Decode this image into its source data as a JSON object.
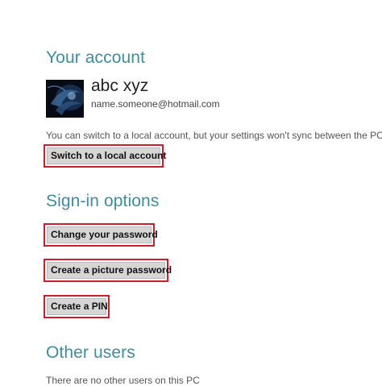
{
  "account": {
    "title": "Your account",
    "user_name": "abc xyz",
    "email": "name.someone@hotmail.com",
    "info": "You can switch to a local account, but your settings won't sync between the PCs",
    "switch_button": "Switch to a local account"
  },
  "signin": {
    "title": "Sign-in options",
    "change_password_button": "Change your password",
    "picture_password_button": "Create a picture password",
    "pin_button": "Create a PIN"
  },
  "other_users": {
    "title": "Other users",
    "info": "There are no other users on this PC"
  },
  "colors": {
    "heading": "#3a8fa0",
    "highlight": "#d01c2c",
    "button_bg": "#d6d6d6"
  }
}
